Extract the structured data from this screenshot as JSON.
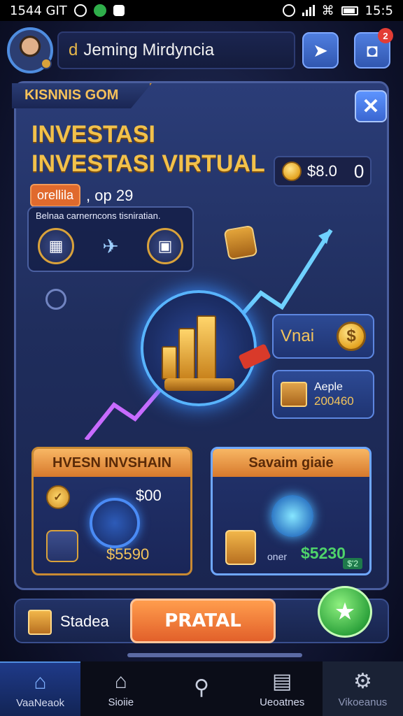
{
  "status_bar": {
    "left_text": "1544 GIT",
    "time": "15:5"
  },
  "header": {
    "user_tag": "d",
    "user_name": "Jeming Mirdyncia",
    "notification_count": "2"
  },
  "panel": {
    "ribbon_label": "KISNNIS GOM",
    "title": "INVESTASI INVESTASI VIRTUAL",
    "coin_counter": {
      "amount": "$8.0",
      "extra": "0"
    },
    "pill_label": "orellila",
    "date": ", op 29",
    "info_caption": "Belnaa carnerncons tisniratian.",
    "side_buttons": {
      "vnai_label": "Vnai",
      "coin_glyph": "$",
      "apple_label": "Aeple",
      "apple_value": "200460"
    },
    "cards": [
      {
        "title": "HVESN INVSHAIN",
        "value_top": "$00",
        "value_bottom": "$5590"
      },
      {
        "title": "Savaim giaie",
        "small_label": "oner",
        "value": "$5230",
        "tag": "$'2"
      }
    ]
  },
  "action_bar": {
    "stat_label": "Stadea",
    "primary_button": "PRATAL"
  },
  "bottom_nav": [
    {
      "label": "VaaNeaok",
      "icon": "home-icon"
    },
    {
      "label": "Sioiie",
      "icon": "store-icon"
    },
    {
      "label": "",
      "icon": "search-icon"
    },
    {
      "label": "Ueoatnes",
      "icon": "inbox-icon"
    },
    {
      "label": "Vikoeanus",
      "icon": "gear-icon"
    }
  ]
}
